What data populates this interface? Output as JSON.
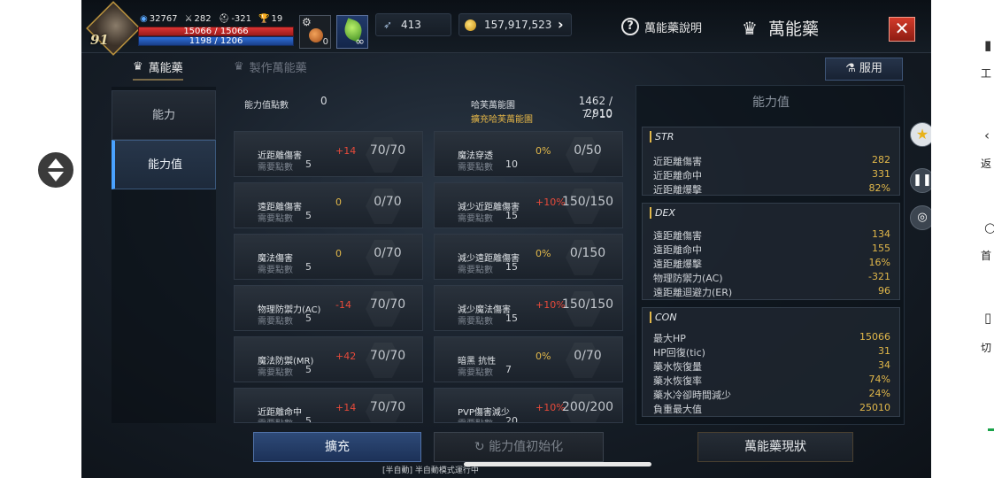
{
  "player": {
    "level": "91",
    "power": "32767",
    "stat_a": "282",
    "stat_b": "-321",
    "stat_c": "19",
    "hp": "15066 / 15066",
    "mp": "1198 / 1206"
  },
  "slots": {
    "potion_count": "0",
    "leaf_count": "∞"
  },
  "currency": {
    "feathers": "413",
    "gold": "157,917,523"
  },
  "header": {
    "help_label": "萬能藥說明",
    "title": "萬能藥",
    "close": "✕"
  },
  "tabs": {
    "active": "萬能藥",
    "inactive": "製作萬能藥",
    "use_label": "服用"
  },
  "menu": [
    {
      "label": "能力"
    },
    {
      "label": "能力值"
    }
  ],
  "summary": {
    "points_label": "能力值點數",
    "points_value": "0",
    "ha_label": "哈芙萬能園",
    "ha_value": "1462 / 2910",
    "ext_label": "擴充哈芙萬能園",
    "ext_value": "7 / 10"
  },
  "need_label": "需要點數",
  "stats_left": [
    {
      "name": "近距離傷害",
      "bonus": "+14",
      "progress": "70/70",
      "need": "5"
    },
    {
      "name": "遠距離傷害",
      "bonus": "0",
      "progress": "0/70",
      "need": "5"
    },
    {
      "name": "魔法傷害",
      "bonus": "0",
      "progress": "0/70",
      "need": "5"
    },
    {
      "name": "物理防禦力(AC)",
      "bonus": "-14",
      "progress": "70/70",
      "need": "5"
    },
    {
      "name": "魔法防禦(MR)",
      "bonus": "+42",
      "progress": "70/70",
      "need": "5"
    },
    {
      "name": "近距離命中",
      "bonus": "+14",
      "progress": "70/70",
      "need": "5"
    }
  ],
  "stats_right": [
    {
      "name": "魔法穿透",
      "bonus": "0%",
      "progress": "0/50",
      "need": "10"
    },
    {
      "name": "減少近距離傷害",
      "bonus": "+10%",
      "progress": "150/150",
      "need": "15"
    },
    {
      "name": "減少遠距離傷害",
      "bonus": "0%",
      "progress": "0/150",
      "need": "15"
    },
    {
      "name": "減少魔法傷害",
      "bonus": "+10%",
      "progress": "150/150",
      "need": "15"
    },
    {
      "name": "暗黑 抗性",
      "bonus": "0%",
      "progress": "0/70",
      "need": "7"
    },
    {
      "name": "PVP傷害減少",
      "bonus": "+10%",
      "progress": "200/200",
      "need": "20"
    }
  ],
  "right_panel": {
    "title": "能力值",
    "groups": [
      {
        "header": "STR",
        "rows": [
          {
            "k": "近距離傷害",
            "v": "282"
          },
          {
            "k": "近距離命中",
            "v": "331"
          },
          {
            "k": "近距離爆擊",
            "v": "82%"
          }
        ]
      },
      {
        "header": "DEX",
        "rows": [
          {
            "k": "遠距離傷害",
            "v": "134"
          },
          {
            "k": "遠距離命中",
            "v": "155"
          },
          {
            "k": "遠距離爆擊",
            "v": "16%"
          },
          {
            "k": "物理防禦力(AC)",
            "v": "-321"
          },
          {
            "k": "遠距離迴避力(ER)",
            "v": "96"
          }
        ]
      },
      {
        "header": "CON",
        "rows": [
          {
            "k": "最大HP",
            "v": "15066"
          },
          {
            "k": "HP回復(tic)",
            "v": "31"
          },
          {
            "k": "藥水恢復量",
            "v": "34"
          },
          {
            "k": "藥水恢復率",
            "v": "74%"
          },
          {
            "k": "藥水冷卻時間減少",
            "v": "24%"
          },
          {
            "k": "負重最大值",
            "v": "25010"
          }
        ]
      }
    ]
  },
  "bottom": {
    "expand_label": "擴充",
    "reset_label": "能力值初始化",
    "status_label": "萬能藥現狀",
    "auto_text": "[半自動] 半自動模式運行中"
  },
  "device_sidebar": {
    "items": [
      "工",
      "返",
      "首",
      "切"
    ]
  },
  "colors": {
    "bonus_positive": "#e84a3a",
    "highlight": "#e2b84a",
    "accent": "#4aa2ff"
  }
}
